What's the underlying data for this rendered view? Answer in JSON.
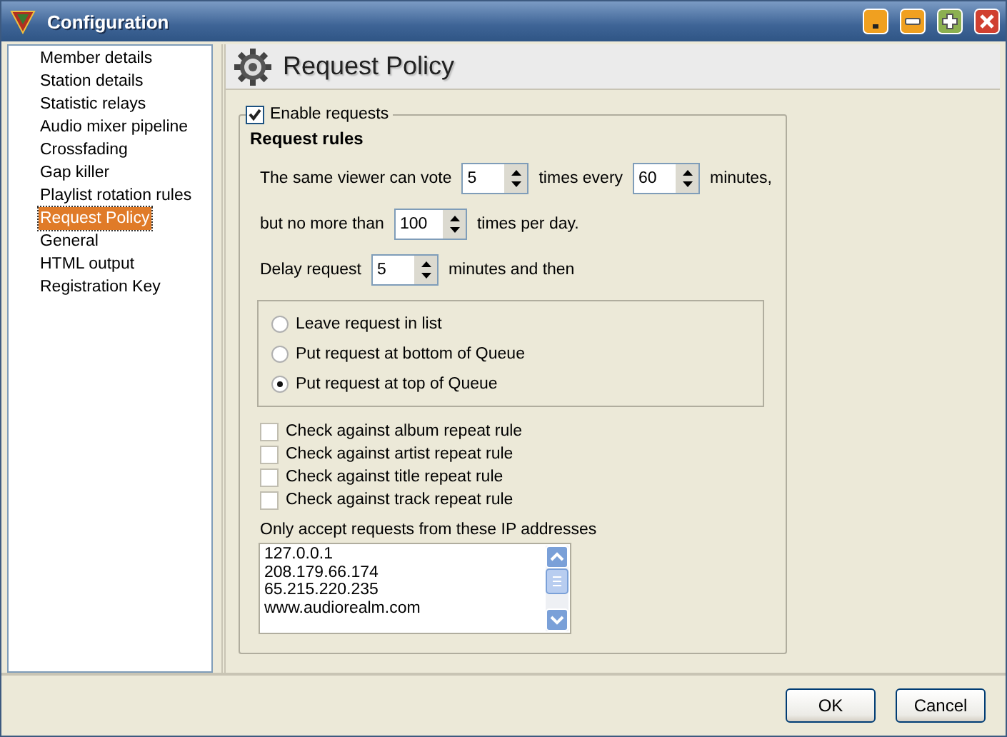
{
  "window": {
    "title": "Configuration"
  },
  "sidebar": {
    "items": [
      {
        "label": "Member details",
        "selected": false
      },
      {
        "label": "Station details",
        "selected": false
      },
      {
        "label": "Statistic relays",
        "selected": false
      },
      {
        "label": "Audio mixer pipeline",
        "selected": false
      },
      {
        "label": "Crossfading",
        "selected": false
      },
      {
        "label": "Gap killer",
        "selected": false
      },
      {
        "label": "Playlist rotation rules",
        "selected": false
      },
      {
        "label": "Request Policy",
        "selected": true
      },
      {
        "label": "General",
        "selected": false
      },
      {
        "label": "HTML output",
        "selected": false
      },
      {
        "label": "Registration Key",
        "selected": false
      }
    ]
  },
  "page_title": "Request Policy",
  "enable_requests": {
    "label": "Enable requests",
    "checked": true
  },
  "section_title": "Request rules",
  "rule_rows": [
    {
      "parts": [
        {
          "kind": "text",
          "text": "The same viewer can vote"
        },
        {
          "kind": "spin",
          "value": "5"
        },
        {
          "kind": "text",
          "text": "times every"
        },
        {
          "kind": "spin",
          "value": "60"
        },
        {
          "kind": "text",
          "text": "minutes,"
        }
      ]
    },
    {
      "parts": [
        {
          "kind": "text",
          "text": "but no more than"
        },
        {
          "kind": "spin",
          "value": "100"
        },
        {
          "kind": "text",
          "text": "times per day."
        }
      ]
    },
    {
      "parts": [
        {
          "kind": "text",
          "text": "Delay request"
        },
        {
          "kind": "spin",
          "value": "5"
        },
        {
          "kind": "text",
          "text": "minutes and then"
        }
      ]
    }
  ],
  "radio_options": [
    {
      "label": "Leave request in list",
      "selected": false
    },
    {
      "label": "Put request at bottom of Queue",
      "selected": false
    },
    {
      "label": "Put request at top of Queue",
      "selected": true
    }
  ],
  "checks": [
    {
      "label": "Check against album repeat rule",
      "checked": false
    },
    {
      "label": "Check against artist repeat rule",
      "checked": false
    },
    {
      "label": "Check against title repeat rule",
      "checked": false
    },
    {
      "label": "Check against track repeat rule",
      "checked": false
    }
  ],
  "ip_label": "Only accept requests from these IP addresses",
  "ip_list": [
    "127.0.0.1",
    "208.179.66.174",
    "65.215.220.235",
    "www.audiorealm.com"
  ],
  "buttons": [
    "OK",
    "Cancel"
  ]
}
